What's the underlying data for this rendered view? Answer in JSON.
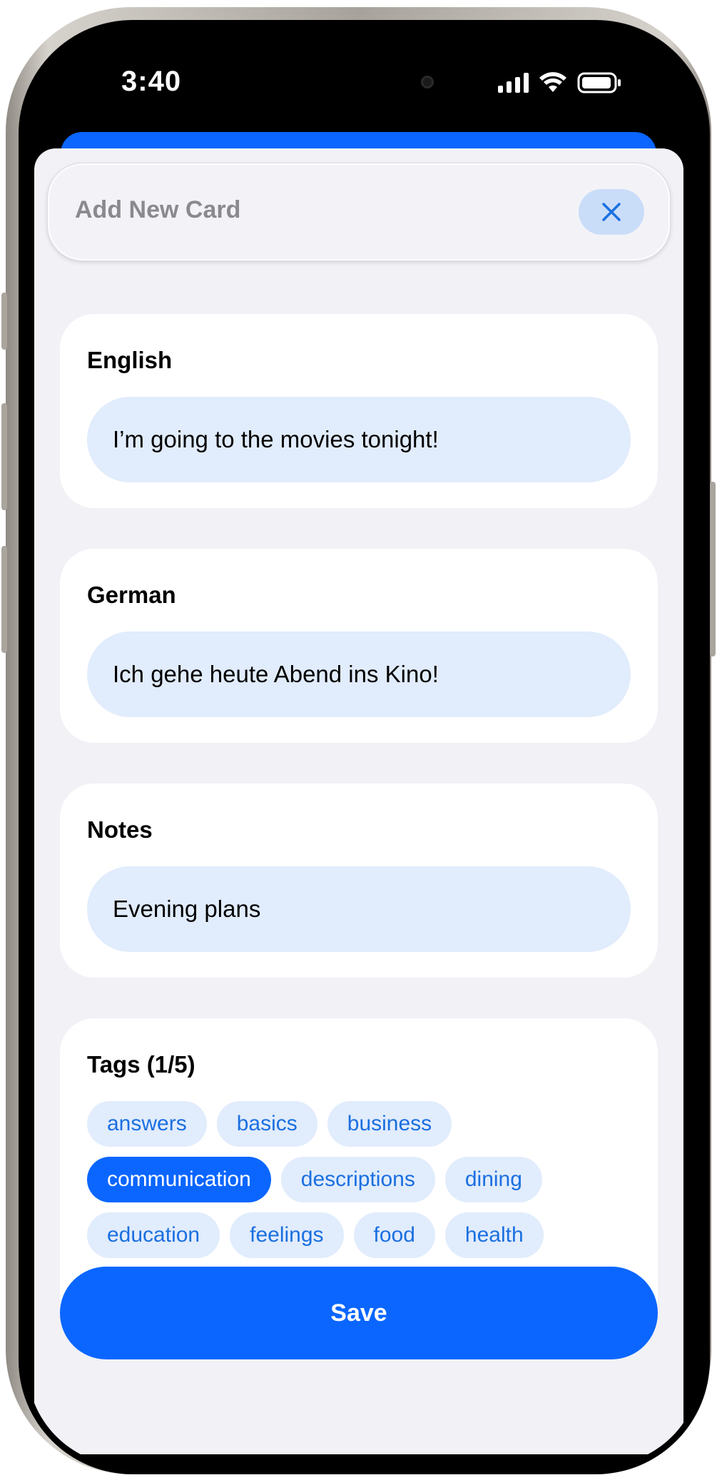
{
  "status_bar": {
    "time": "3:40",
    "icons": [
      "cellular-signal-icon",
      "wifi-icon",
      "battery-icon"
    ]
  },
  "header": {
    "title": "Add New Card",
    "close_icon": "close-icon"
  },
  "fields": {
    "english": {
      "label": "English",
      "value": "I’m going to the movies tonight!"
    },
    "german": {
      "label": "German",
      "value": "Ich gehe heute Abend ins Kino!"
    },
    "notes": {
      "label": "Notes",
      "value": "Evening plans"
    }
  },
  "tags": {
    "label": "Tags (1/5)",
    "items": [
      {
        "label": "answers",
        "selected": false
      },
      {
        "label": "basics",
        "selected": false
      },
      {
        "label": "business",
        "selected": false
      },
      {
        "label": "communication",
        "selected": true
      },
      {
        "label": "descriptions",
        "selected": false
      },
      {
        "label": "dining",
        "selected": false
      },
      {
        "label": "education",
        "selected": false
      },
      {
        "label": "feelings",
        "selected": false
      },
      {
        "label": "food",
        "selected": false
      },
      {
        "label": "health",
        "selected": false
      }
    ]
  },
  "actions": {
    "save_label": "Save"
  },
  "colors": {
    "accent": "#0a66ff",
    "field_bg": "#e1ecfc",
    "tag_text": "#1a6fe0",
    "sheet_bg": "#f1f1f6"
  }
}
